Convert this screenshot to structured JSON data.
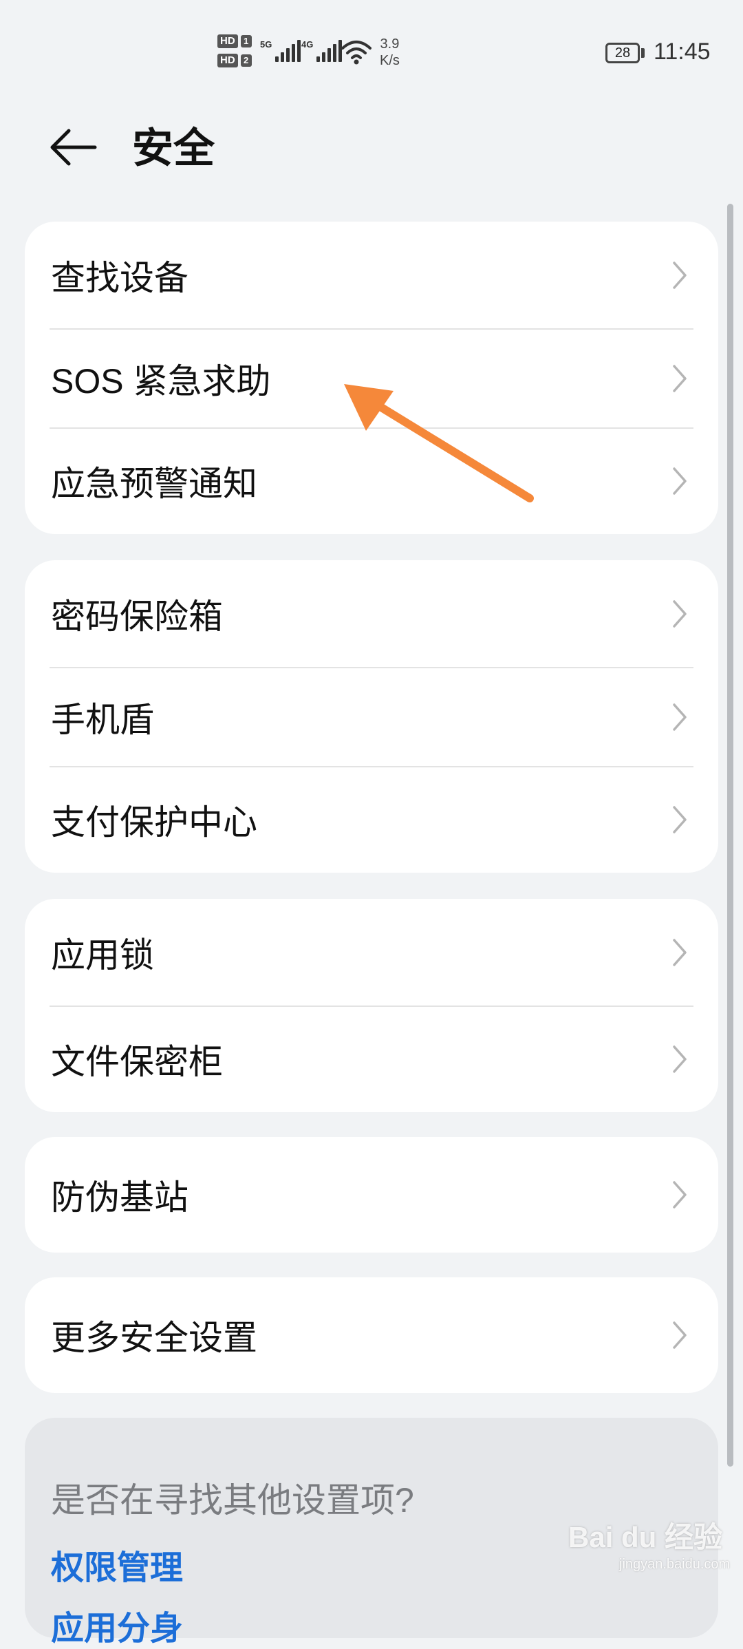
{
  "status_bar": {
    "sim1_label": "HD",
    "sim1_num": "1",
    "sim2_label": "HD",
    "sim2_num": "2",
    "net1_label": "5G",
    "net2_label": "4G",
    "speed_value": "3.9",
    "speed_unit": "K/s",
    "battery": "28",
    "time": "11:45"
  },
  "header": {
    "title": "安全"
  },
  "groups": [
    {
      "items": [
        "查找设备",
        "SOS 紧急求助",
        "应急预警通知"
      ]
    },
    {
      "items": [
        "密码保险箱",
        "手机盾",
        "支付保护中心"
      ]
    },
    {
      "items": [
        "应用锁",
        "文件保密柜"
      ]
    },
    {
      "items": [
        "防伪基站"
      ]
    },
    {
      "items": [
        "更多安全设置"
      ]
    }
  ],
  "suggestions": {
    "title": "是否在寻找其他设置项?",
    "links": [
      "权限管理",
      "应用分身"
    ]
  },
  "watermark": {
    "text": "Bai du 经验",
    "sub": "jingyan.baidu.com"
  },
  "annotation": {
    "arrow_color": "#f5883a"
  }
}
